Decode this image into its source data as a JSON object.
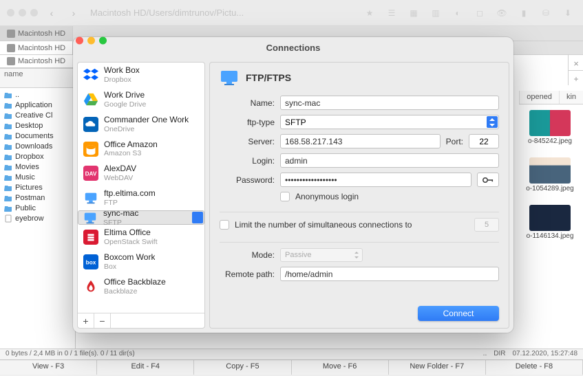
{
  "window": {
    "path": "Macintosh HD/Users/dimtrunov/Pictu...",
    "tab": "Macintosh HD"
  },
  "sidebar": {
    "name_col": "name",
    "items": [
      {
        "label": ".."
      },
      {
        "label": "Application"
      },
      {
        "label": "Creative Cl"
      },
      {
        "label": "Desktop"
      },
      {
        "label": "Documents"
      },
      {
        "label": "Downloads"
      },
      {
        "label": "Dropbox"
      },
      {
        "label": "Movies"
      },
      {
        "label": "Music"
      },
      {
        "label": "Pictures"
      },
      {
        "label": "Postman"
      },
      {
        "label": "Public"
      },
      {
        "label": "eyebrow"
      }
    ]
  },
  "rightpane": {
    "cols": {
      "opened": "opened",
      "kin": "kin"
    },
    "thumbs": [
      {
        "cap": "o-845242.jpeg"
      },
      {
        "cap": "o-1054289.jpeg"
      },
      {
        "cap": "o-1146134.jpeg"
      }
    ]
  },
  "status": {
    "left": "0 bytes / 2,4 MB in 0 / 1 file(s). 0 / 11 dir(s)",
    "dots": "..",
    "dir": "DIR",
    "date": "07.12.2020, 15:27:48"
  },
  "fkeys": {
    "view": "View - F3",
    "edit": "Edit - F4",
    "copy": "Copy - F5",
    "move": "Move - F6",
    "newf": "New Folder - F7",
    "del": "Delete - F8"
  },
  "dialog": {
    "title": "Connections",
    "connect_btn": "Connect",
    "connections": [
      {
        "name": "Work Box",
        "sub": "Dropbox",
        "icon": "dropbox"
      },
      {
        "name": "Work Drive",
        "sub": "Google Drive",
        "icon": "gdrive"
      },
      {
        "name": "Commander One Work",
        "sub": "OneDrive",
        "icon": "onedrive"
      },
      {
        "name": "Office Amazon",
        "sub": "Amazon S3",
        "icon": "s3"
      },
      {
        "name": "AlexDAV",
        "sub": "WebDAV",
        "icon": "webdav"
      },
      {
        "name": "ftp.eltima.com",
        "sub": "FTP",
        "icon": "ftp"
      },
      {
        "name": "sync-mac",
        "sub": "SFTP",
        "icon": "ftp",
        "selected": true
      },
      {
        "name": "Eltima Office",
        "sub": "OpenStack Swift",
        "icon": "swift"
      },
      {
        "name": "Boxcom Work",
        "sub": "Box",
        "icon": "box"
      },
      {
        "name": "Office Backblaze",
        "sub": "Backblaze",
        "icon": "backblaze"
      }
    ],
    "form": {
      "heading": "FTP/FTPS",
      "labels": {
        "name": "Name:",
        "ftptype": "ftp-type",
        "server": "Server:",
        "port": "Port:",
        "login": "Login:",
        "password": "Password:",
        "anon": "Anonymous login",
        "limit": "Limit the number of simultaneous connections to",
        "mode": "Mode:",
        "remote": "Remote path:"
      },
      "values": {
        "name": "sync-mac",
        "ftptype": "SFTP",
        "server": "168.58.217.143",
        "port": "22",
        "login": "admin",
        "password": "••••••••••••••••••",
        "limit_n": "5",
        "mode": "Passive",
        "remote": "/home/admin"
      }
    }
  }
}
